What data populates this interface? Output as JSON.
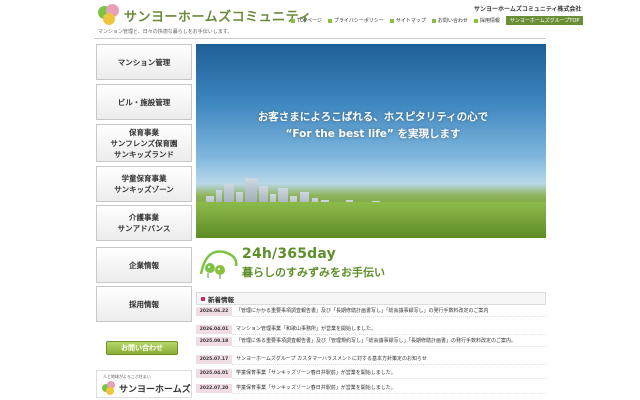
{
  "header": {
    "logo_text": "サンヨーホームズコミュニティ",
    "company_name": "サンヨーホームズコミュニティ株式会社",
    "tagline": "マンション管理と、日々の快適な暮らしをお手伝いします。",
    "links": [
      {
        "label": "TOPページ"
      },
      {
        "label": "プライバシーポリシー"
      },
      {
        "label": "サイトマップ"
      },
      {
        "label": "お問い合わせ"
      },
      {
        "label": "採用情報"
      }
    ],
    "group_link": "サンヨーホームズグループTOP"
  },
  "sidebar": {
    "items": [
      {
        "lines": [
          "マンション管理"
        ]
      },
      {
        "lines": [
          "ビル・施設管理"
        ]
      },
      {
        "lines": [
          "保育事業",
          "サンフレンズ保育園",
          "サンキッズランド"
        ]
      },
      {
        "lines": [
          "学童保育事業",
          "サンキッズゾーン"
        ]
      },
      {
        "lines": [
          "介護事業",
          "サンアドバンス"
        ]
      },
      {
        "lines": [
          "企業情報"
        ]
      },
      {
        "lines": [
          "採用情報"
        ]
      }
    ],
    "consult_button": "お問い合わせ",
    "bottom_logo": {
      "tagline": "人と地球がよろこぶ住まい",
      "name": "サンヨーホームズ"
    }
  },
  "hero": {
    "line1": "お客さまによろこばれる、ホスピタリティの心で",
    "line2": "“For the best life” を実現します"
  },
  "service": {
    "title": "24h/365day",
    "subtitle": "暮らしのすみずみをお手伝い"
  },
  "news": {
    "heading": "新着情報",
    "items": [
      {
        "date": "2026.06.22",
        "text": "「管理にかかる重要事項調査報告書」及び「長期修繕計画書写し」「総会議事録写し」の発行手数料改定のご案内"
      },
      {
        "date": "2026.04.01",
        "text": "マンション管理事業「和歌山事務所」が営業を開始しました。"
      },
      {
        "date": "2025.09.18",
        "text": "「管理に係る重要事項調査報告書」及び「管理規約写し」「総会議事録写し」「長期修繕計画書」の発行手数料改定のご案内。"
      },
      {
        "date": "2025.07.17",
        "text": "サンヨーホームズグループ カスタマーハラスメントに対する基本方針策定のお知らせ"
      },
      {
        "date": "2025.04.01",
        "text": "学童保育事業「サンキッズゾーン春日井駅前」が営業を開始しました。"
      },
      {
        "date": "2022.07.20",
        "text": "学童保育事業「サンキッズゾーン春日井駅前」が営業を開始しました。"
      }
    ]
  },
  "colors": {
    "accent_green": "#6a8f35",
    "news_date_bg": "#f1dce6",
    "hero_sky": "#3d86bf"
  }
}
